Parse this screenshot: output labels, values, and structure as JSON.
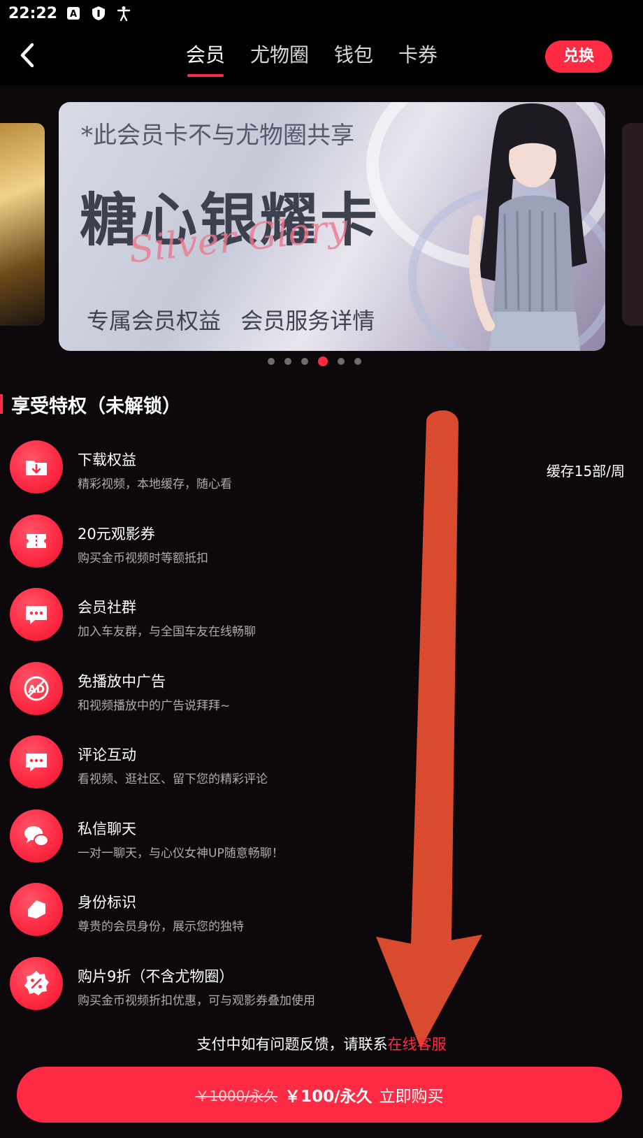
{
  "status_bar": {
    "time": "22:22"
  },
  "nav": {
    "tabs": [
      {
        "label": "会员",
        "active": true
      },
      {
        "label": "尤物圈",
        "active": false
      },
      {
        "label": "钱包",
        "active": false
      },
      {
        "label": "卡券",
        "active": false
      }
    ],
    "redeem_label": "兑换"
  },
  "banner": {
    "note": "*此会员卡不与尤物圈共享",
    "title": "糖心银耀卡",
    "script": "Silver Glory",
    "link_benefits": "专属会员权益",
    "link_service": "会员服务详情",
    "carousel_count": 6,
    "carousel_active_index": 3
  },
  "section": {
    "title": "享受特权（未解锁）"
  },
  "benefits": [
    {
      "icon": "download-folder-icon",
      "title": "下载权益",
      "desc": "精彩视频，本地缓存，随心看",
      "extra": "缓存15部/周"
    },
    {
      "icon": "ticket-icon",
      "title": "20元观影券",
      "desc": "购买金币视频时等额抵扣",
      "extra": ""
    },
    {
      "icon": "chat-bubble-icon",
      "title": "会员社群",
      "desc": "加入车友群，与全国车友在线畅聊",
      "extra": ""
    },
    {
      "icon": "no-ad-icon",
      "title": "免播放中广告",
      "desc": "和视频播放中的广告说拜拜~",
      "extra": ""
    },
    {
      "icon": "comment-icon",
      "title": "评论互动",
      "desc": "看视频、逛社区、留下您的精彩评论",
      "extra": ""
    },
    {
      "icon": "private-message-icon",
      "title": "私信聊天",
      "desc": "一对一聊天，与心仪女神UP随意畅聊！",
      "extra": ""
    },
    {
      "icon": "identity-tag-icon",
      "title": "身份标识",
      "desc": "尊贵的会员身份，展示您的独特",
      "extra": ""
    },
    {
      "icon": "discount-badge-icon",
      "title": "购片9折（不含尤物圈）",
      "desc": "购买金币视频折扣优惠，可与观影券叠加使用",
      "extra": ""
    }
  ],
  "support": {
    "text": "支付中如有问题反馈，请联系",
    "link": "在线客服"
  },
  "buy": {
    "old_price": "￥1000/永久",
    "price": "￥100/永久",
    "action": "立即购买"
  },
  "colors": {
    "accent": "#ff2b45",
    "background": "#0d080b",
    "annotation_arrow": "#d94a2f"
  }
}
